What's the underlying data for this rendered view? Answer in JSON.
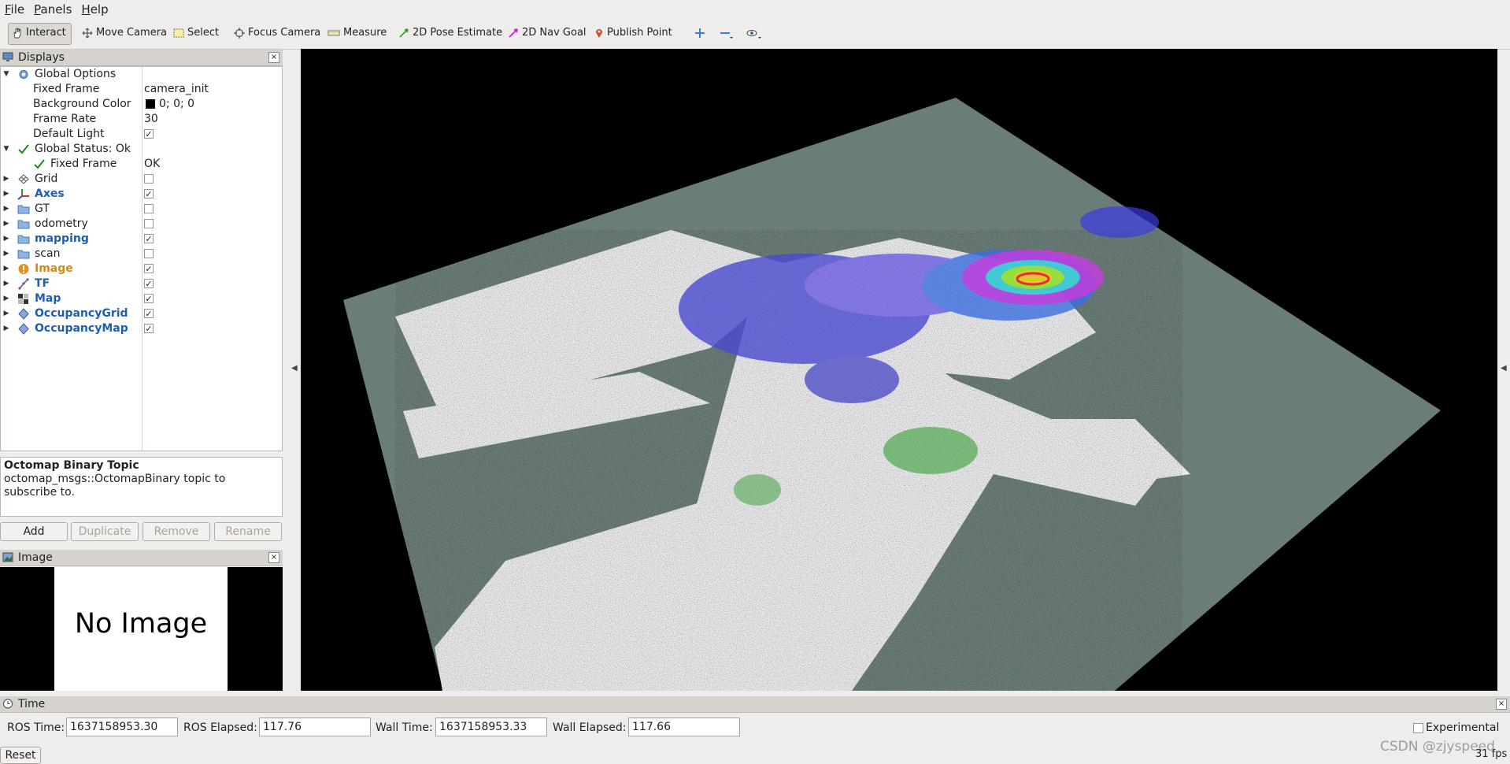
{
  "menu": [
    "File",
    "Panels",
    "Help"
  ],
  "toolbar": {
    "tools": [
      {
        "label": "Interact",
        "icon": "hand-icon"
      },
      {
        "label": "Move Camera",
        "icon": "move-icon"
      },
      {
        "label": "Select",
        "icon": "select-icon"
      },
      {
        "label": "Focus Camera",
        "icon": "focus-icon"
      },
      {
        "label": "Measure",
        "icon": "ruler-icon"
      },
      {
        "label": "2D Pose Estimate",
        "icon": "green-arrow-icon"
      },
      {
        "label": "2D Nav Goal",
        "icon": "magenta-arrow-icon"
      },
      {
        "label": "Publish Point",
        "icon": "pin-icon"
      }
    ],
    "icons": [
      "plus-icon",
      "minus-icon",
      "eye-icon"
    ]
  },
  "displays_panel": {
    "title": "Displays",
    "rows": [
      {
        "label": "Global Options",
        "value": ""
      },
      {
        "label": "Fixed Frame",
        "value": "camera_init"
      },
      {
        "label": "Background Color",
        "value": "0; 0; 0"
      },
      {
        "label": "Frame Rate",
        "value": "30"
      },
      {
        "label": "Default Light",
        "value": "✓"
      },
      {
        "label": "Global Status: Ok",
        "value": ""
      },
      {
        "label": "Fixed Frame",
        "value": "OK"
      },
      {
        "label": "Grid",
        "value": ""
      },
      {
        "label": "Axes",
        "value": "✓"
      },
      {
        "label": "GT",
        "value": ""
      },
      {
        "label": "odometry",
        "value": ""
      },
      {
        "label": "mapping",
        "value": "✓"
      },
      {
        "label": "scan",
        "value": ""
      },
      {
        "label": "Image",
        "value": "✓"
      },
      {
        "label": "TF",
        "value": "✓"
      },
      {
        "label": "Map",
        "value": "✓"
      },
      {
        "label": "OccupancyGrid",
        "value": "✓"
      },
      {
        "label": "OccupancyMap",
        "value": "✓"
      }
    ],
    "colors": {
      "blue_label": "#1e5fb4",
      "warning": "#d08a1a"
    }
  },
  "description": {
    "title": "Octomap Binary Topic",
    "text": "octomap_msgs::OctomapBinary topic to subscribe to."
  },
  "buttons": {
    "add": "Add",
    "duplicate": "Duplicate",
    "remove": "Remove",
    "rename": "Rename"
  },
  "image_panel": {
    "title": "Image",
    "placeholder": "No Image"
  },
  "time_panel": {
    "title": "Time",
    "ros_time_label": "ROS Time:",
    "ros_time": "1637158953.30",
    "ros_elapsed_label": "ROS Elapsed:",
    "ros_elapsed": "117.76",
    "wall_time_label": "Wall Time:",
    "wall_time": "1637158953.33",
    "wall_elapsed_label": "Wall Elapsed:",
    "wall_elapsed": "117.66",
    "experimental": "Experimental",
    "reset": "Reset",
    "fps": "31 fps"
  },
  "watermark": "CSDN @zjyspeed",
  "viewport_colors": {
    "background": "#000000",
    "plane": "#6b7d78",
    "points": "#e8e8ea"
  }
}
